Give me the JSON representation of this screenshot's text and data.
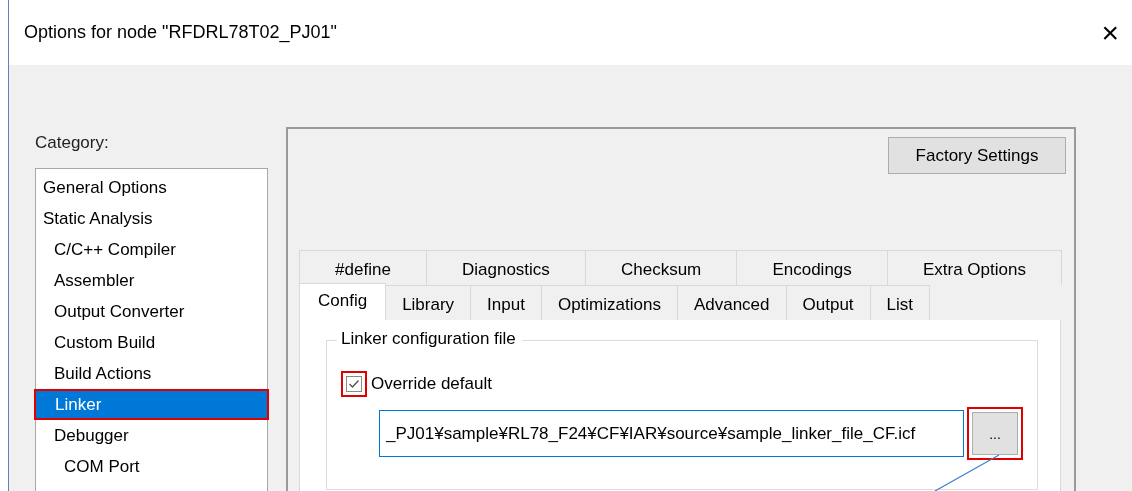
{
  "window": {
    "title": "Options for node \"RFDRL78T02_PJ01\"",
    "close": "×"
  },
  "category": {
    "label": "Category:",
    "items": [
      {
        "label": "General Options",
        "selected": false,
        "highlighted": false
      },
      {
        "label": "Static Analysis",
        "selected": false,
        "highlighted": false,
        "children": [
          {
            "label": "C/C++ Compiler",
            "selected": false,
            "highlighted": false
          },
          {
            "label": "Assembler",
            "selected": false,
            "highlighted": false
          },
          {
            "label": "Output Converter",
            "selected": false,
            "highlighted": false
          },
          {
            "label": "Custom Build",
            "selected": false,
            "highlighted": false
          },
          {
            "label": "Build Actions",
            "selected": false,
            "highlighted": false
          },
          {
            "label": "Linker",
            "selected": true,
            "highlighted": true
          },
          {
            "label": "Debugger",
            "selected": false,
            "highlighted": false,
            "children": [
              {
                "label": "COM Port",
                "selected": false,
                "highlighted": false
              }
            ]
          }
        ]
      }
    ]
  },
  "factory_button": "Factory Settings",
  "tab_rows": [
    [
      {
        "label": "#define",
        "selected": false
      },
      {
        "label": "Diagnostics",
        "selected": false
      },
      {
        "label": "Checksum",
        "selected": false
      },
      {
        "label": "Encodings",
        "selected": false
      },
      {
        "label": "Extra Options",
        "selected": false
      }
    ],
    [
      {
        "label": "Config",
        "selected": true
      },
      {
        "label": "Library",
        "selected": false
      },
      {
        "label": "Input",
        "selected": false
      },
      {
        "label": "Optimizations",
        "selected": false
      },
      {
        "label": "Advanced",
        "selected": false
      },
      {
        "label": "Output",
        "selected": false
      },
      {
        "label": "List",
        "selected": false
      }
    ]
  ],
  "group": {
    "title": "Linker configuration file",
    "checkbox": {
      "label": "Override default",
      "checked": true,
      "highlighted": true
    },
    "path": "_PJ01¥sample¥RL78_F24¥CF¥IAR¥source¥sample_linker_file_CF.icf",
    "browse": {
      "label": "...",
      "highlighted": true
    }
  }
}
